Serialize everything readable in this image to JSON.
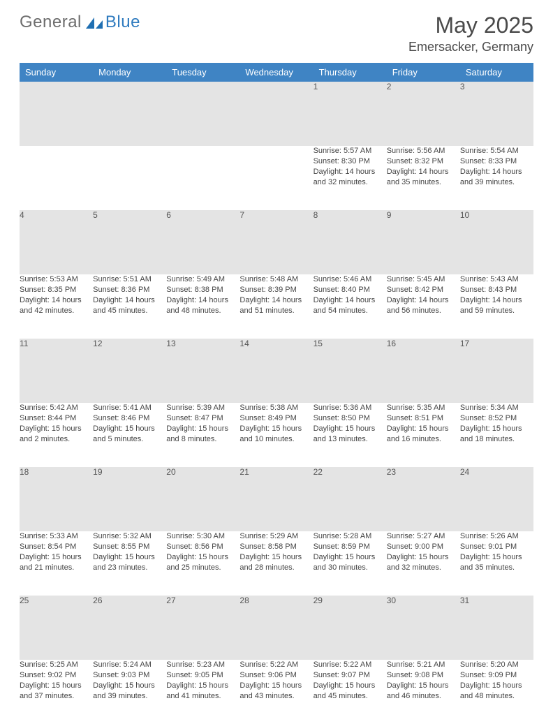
{
  "brand": {
    "word1": "General",
    "word2": "Blue"
  },
  "title": "May 2025",
  "location": "Emersacker, Germany",
  "colors": {
    "header_blue": "#3f84c4",
    "daynum_gray": "#e4e4e4"
  },
  "day_headers": [
    "Sunday",
    "Monday",
    "Tuesday",
    "Wednesday",
    "Thursday",
    "Friday",
    "Saturday"
  ],
  "weeks": [
    [
      null,
      null,
      null,
      null,
      {
        "n": "1",
        "sr": "5:57 AM",
        "ss": "8:30 PM",
        "dl": "14 hours and 32 minutes."
      },
      {
        "n": "2",
        "sr": "5:56 AM",
        "ss": "8:32 PM",
        "dl": "14 hours and 35 minutes."
      },
      {
        "n": "3",
        "sr": "5:54 AM",
        "ss": "8:33 PM",
        "dl": "14 hours and 39 minutes."
      }
    ],
    [
      {
        "n": "4",
        "sr": "5:53 AM",
        "ss": "8:35 PM",
        "dl": "14 hours and 42 minutes."
      },
      {
        "n": "5",
        "sr": "5:51 AM",
        "ss": "8:36 PM",
        "dl": "14 hours and 45 minutes."
      },
      {
        "n": "6",
        "sr": "5:49 AM",
        "ss": "8:38 PM",
        "dl": "14 hours and 48 minutes."
      },
      {
        "n": "7",
        "sr": "5:48 AM",
        "ss": "8:39 PM",
        "dl": "14 hours and 51 minutes."
      },
      {
        "n": "8",
        "sr": "5:46 AM",
        "ss": "8:40 PM",
        "dl": "14 hours and 54 minutes."
      },
      {
        "n": "9",
        "sr": "5:45 AM",
        "ss": "8:42 PM",
        "dl": "14 hours and 56 minutes."
      },
      {
        "n": "10",
        "sr": "5:43 AM",
        "ss": "8:43 PM",
        "dl": "14 hours and 59 minutes."
      }
    ],
    [
      {
        "n": "11",
        "sr": "5:42 AM",
        "ss": "8:44 PM",
        "dl": "15 hours and 2 minutes."
      },
      {
        "n": "12",
        "sr": "5:41 AM",
        "ss": "8:46 PM",
        "dl": "15 hours and 5 minutes."
      },
      {
        "n": "13",
        "sr": "5:39 AM",
        "ss": "8:47 PM",
        "dl": "15 hours and 8 minutes."
      },
      {
        "n": "14",
        "sr": "5:38 AM",
        "ss": "8:49 PM",
        "dl": "15 hours and 10 minutes."
      },
      {
        "n": "15",
        "sr": "5:36 AM",
        "ss": "8:50 PM",
        "dl": "15 hours and 13 minutes."
      },
      {
        "n": "16",
        "sr": "5:35 AM",
        "ss": "8:51 PM",
        "dl": "15 hours and 16 minutes."
      },
      {
        "n": "17",
        "sr": "5:34 AM",
        "ss": "8:52 PM",
        "dl": "15 hours and 18 minutes."
      }
    ],
    [
      {
        "n": "18",
        "sr": "5:33 AM",
        "ss": "8:54 PM",
        "dl": "15 hours and 21 minutes."
      },
      {
        "n": "19",
        "sr": "5:32 AM",
        "ss": "8:55 PM",
        "dl": "15 hours and 23 minutes."
      },
      {
        "n": "20",
        "sr": "5:30 AM",
        "ss": "8:56 PM",
        "dl": "15 hours and 25 minutes."
      },
      {
        "n": "21",
        "sr": "5:29 AM",
        "ss": "8:58 PM",
        "dl": "15 hours and 28 minutes."
      },
      {
        "n": "22",
        "sr": "5:28 AM",
        "ss": "8:59 PM",
        "dl": "15 hours and 30 minutes."
      },
      {
        "n": "23",
        "sr": "5:27 AM",
        "ss": "9:00 PM",
        "dl": "15 hours and 32 minutes."
      },
      {
        "n": "24",
        "sr": "5:26 AM",
        "ss": "9:01 PM",
        "dl": "15 hours and 35 minutes."
      }
    ],
    [
      {
        "n": "25",
        "sr": "5:25 AM",
        "ss": "9:02 PM",
        "dl": "15 hours and 37 minutes."
      },
      {
        "n": "26",
        "sr": "5:24 AM",
        "ss": "9:03 PM",
        "dl": "15 hours and 39 minutes."
      },
      {
        "n": "27",
        "sr": "5:23 AM",
        "ss": "9:05 PM",
        "dl": "15 hours and 41 minutes."
      },
      {
        "n": "28",
        "sr": "5:22 AM",
        "ss": "9:06 PM",
        "dl": "15 hours and 43 minutes."
      },
      {
        "n": "29",
        "sr": "5:22 AM",
        "ss": "9:07 PM",
        "dl": "15 hours and 45 minutes."
      },
      {
        "n": "30",
        "sr": "5:21 AM",
        "ss": "9:08 PM",
        "dl": "15 hours and 46 minutes."
      },
      {
        "n": "31",
        "sr": "5:20 AM",
        "ss": "9:09 PM",
        "dl": "15 hours and 48 minutes."
      }
    ]
  ],
  "labels": {
    "sunrise": "Sunrise: ",
    "sunset": "Sunset: ",
    "daylight": "Daylight: "
  }
}
